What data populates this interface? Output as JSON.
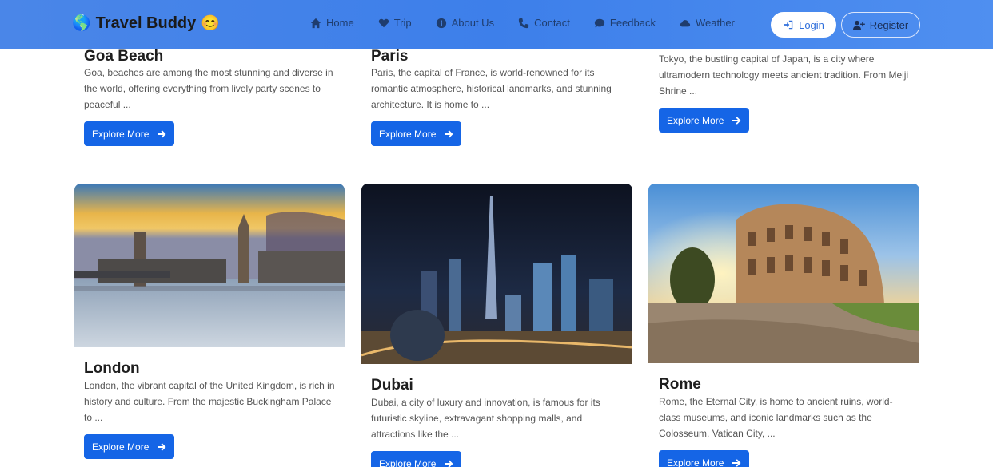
{
  "brand": {
    "name": "Travel Buddy",
    "left_emoji": "🌎",
    "right_emoji": "😊"
  },
  "nav": {
    "items": [
      {
        "label": "Home",
        "icon": "home-icon"
      },
      {
        "label": "Trip",
        "icon": "heart-icon"
      },
      {
        "label": "About Us",
        "icon": "info-icon"
      },
      {
        "label": "Contact",
        "icon": "phone-icon"
      },
      {
        "label": "Feedback",
        "icon": "comment-icon"
      },
      {
        "label": "Weather",
        "icon": "cloud-icon"
      }
    ],
    "login_label": "Login",
    "register_label": "Register"
  },
  "destinations": [
    {
      "title": "Goa Beach",
      "text": "Goa, beaches are among the most stunning and diverse in the world, offering everything from lively party scenes to peaceful ...",
      "button": "Explore More"
    },
    {
      "title": "Paris",
      "text": "Paris, the capital of France, is world-renowned for its romantic atmosphere, historical landmarks, and stunning architecture. It is home to ...",
      "button": "Explore More"
    },
    {
      "title": "",
      "text": "Tokyo, the bustling capital of Japan, is a city where ultramodern technology meets ancient tradition. From Meiji Shrine ...",
      "button": "Explore More"
    },
    {
      "title": "London",
      "text": "London, the vibrant capital of the United Kingdom, is rich in history and culture. From the majestic Buckingham Palace to ...",
      "button": "Explore More"
    },
    {
      "title": "Dubai",
      "text": "Dubai, a city of luxury and innovation, is famous for its futuristic skyline, extravagant shopping malls, and attractions like the ...",
      "button": "Explore More"
    },
    {
      "title": "Rome",
      "text": "Rome, the Eternal City, is home to ancient ruins, world-class museums, and iconic landmarks such as the Colosseum, Vatican City, ...",
      "button": "Explore More"
    }
  ],
  "colors": {
    "navbar": "#4a86e8",
    "button": "#1565e6"
  }
}
